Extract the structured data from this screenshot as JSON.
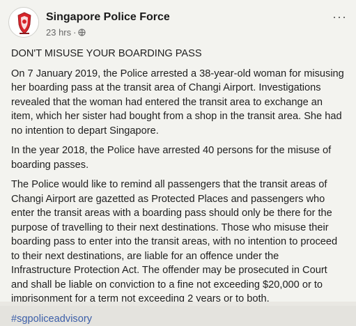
{
  "header": {
    "page_name": "Singapore Police Force",
    "time": "23 hrs",
    "separator": "·",
    "privacy_icon": "globe-icon",
    "more_label": "···"
  },
  "post": {
    "title": "DON'T MISUSE YOUR BOARDING PASS",
    "paragraph_1": "On 7 January 2019, the Police arrested a 38-year-old woman for misusing\nher boarding pass at the transit area of Changi Airport. Investigations\nrevealed that the woman had entered the transit area to exchange an\nitem, which her sister had bought from a shop in the transit area. She had\nno intention to depart Singapore.",
    "paragraph_2": "In the year 2018, the Police have arrested 40 persons for the misuse of\nboarding passes.",
    "paragraph_3": "The Police would like to remind all passengers that the transit areas of\nChangi Airport are gazetted as Protected Places and passengers who\nenter the transit areas with a boarding pass should only be there for the\npurpose of travelling to their next destinations. Those who misuse their\nboarding pass to enter into the transit areas, with no intention to proceed\nto their next destinations, are liable for an offence under the\nInfrastructure Protection Act. The offender may be prosecuted in Court\nand shall be liable on conviction to a fine not exceeding $20,000 or to\nimprisonment for a term not exceeding 2 years or to both.",
    "hashtag": "#sgpoliceadvisory"
  },
  "colors": {
    "background": "#f3f3ef",
    "text": "#1e1e1e",
    "link": "#3b5ea8",
    "logo_red": "#d6252b"
  }
}
